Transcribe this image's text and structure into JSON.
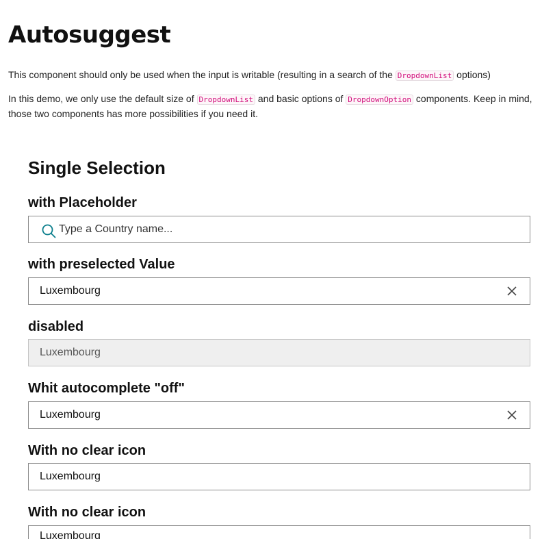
{
  "page": {
    "title": "Autosuggest",
    "intro1": {
      "before": "This component should only be used when the input is writable (resulting in a search of the ",
      "code": "DropdownList",
      "after": " options)"
    },
    "intro2": {
      "part1": "In this demo, we only use the default size of ",
      "code1": "DropdownList",
      "part2": " and basic options of ",
      "code2": "DropdownOption",
      "part3": " components. Keep in mind, those two components has more possibilities if you need it."
    }
  },
  "section": {
    "title": "Single Selection"
  },
  "fields": [
    {
      "label": "with Placeholder",
      "value": "",
      "placeholder": "Type a Country name...",
      "icon": "search-icon"
    },
    {
      "label": "with preselected Value",
      "value": "Luxembourg",
      "icon": "close-icon"
    },
    {
      "label": "disabled",
      "value": "Luxembourg",
      "disabled": true
    },
    {
      "label": "Whit autocomplete \"off\"",
      "value": "Luxembourg",
      "icon": "close-icon"
    },
    {
      "label": "With no clear icon",
      "value": "Luxembourg"
    },
    {
      "label": "With no clear icon",
      "value": "Luxembourg"
    }
  ],
  "colors": {
    "accent": "#0a7e8c",
    "code_text": "#d10b7a",
    "disabled_bg": "#efefef"
  }
}
